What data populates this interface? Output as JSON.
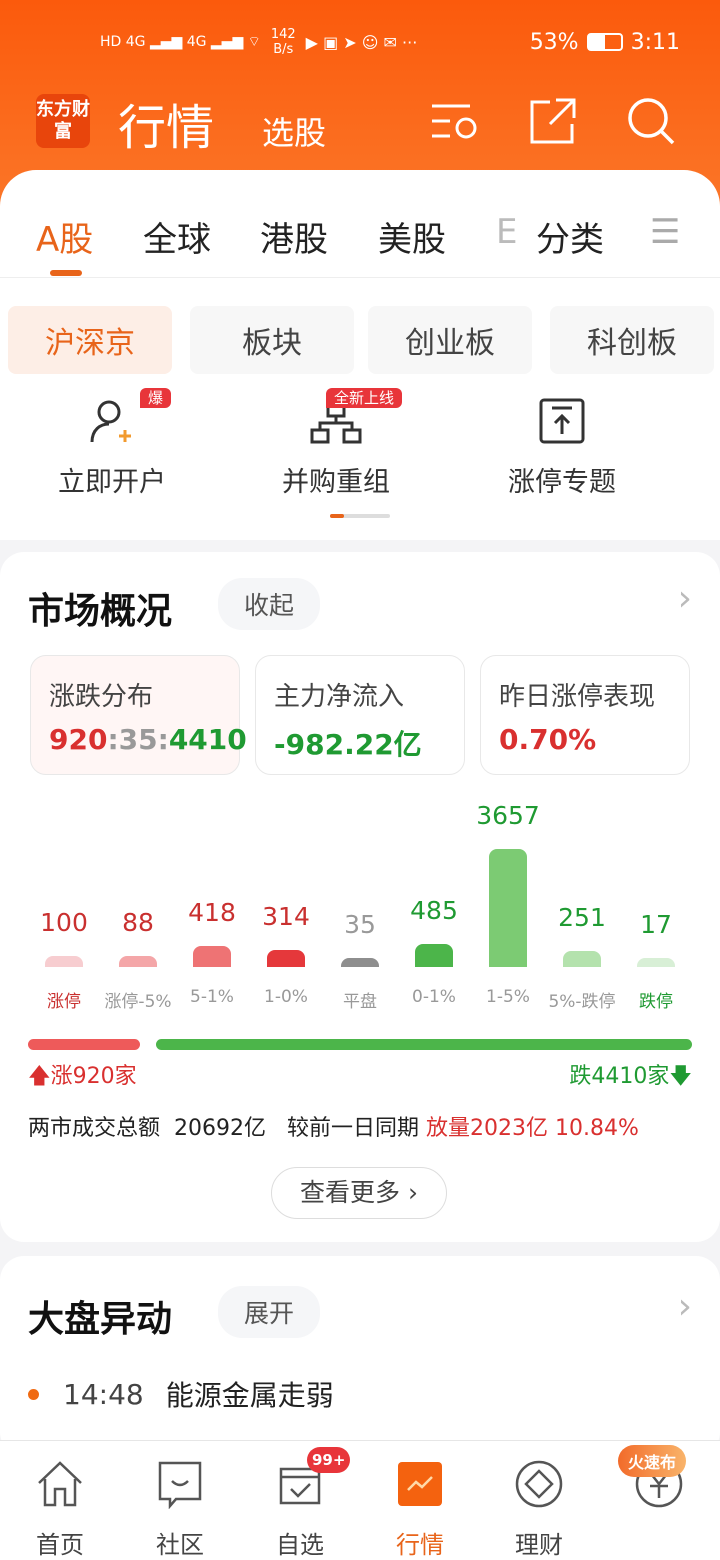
{
  "status_bar": {
    "net_speed": "142",
    "net_unit": "B/s",
    "battery": "53%",
    "time": "3:11"
  },
  "header": {
    "logo": "东方财富",
    "title": "行情",
    "subtitle": "选股"
  },
  "tabs": [
    {
      "label": "A股"
    },
    {
      "label": "全球"
    },
    {
      "label": "港股"
    },
    {
      "label": "美股"
    },
    {
      "label": "E"
    },
    {
      "label": "分类"
    }
  ],
  "sub_tabs": [
    {
      "label": "沪深京"
    },
    {
      "label": "板块"
    },
    {
      "label": "创业板"
    },
    {
      "label": "科创板"
    }
  ],
  "shortcuts": [
    {
      "label": "立即开户",
      "tag": "爆"
    },
    {
      "label": "并购重组",
      "tag": "全新上线"
    },
    {
      "label": "涨停专题"
    }
  ],
  "market": {
    "title": "市场概况",
    "toggle": "收起",
    "cards": [
      {
        "label": "涨跌分布",
        "up": "920",
        "sep1": ":",
        "flat": "35",
        "sep2": ":",
        "down": "4410"
      },
      {
        "label": "主力净流入",
        "value": "-982.22亿"
      },
      {
        "label": "昨日涨停表现",
        "value": "0.70%"
      }
    ],
    "up_total": "涨920家",
    "down_total": "跌4410家",
    "turnover_label": "两市成交总额",
    "turnover": "20692亿",
    "compare_label": "较前一日同期",
    "compare_value": "放量2023亿",
    "compare_pct": "10.84%",
    "more": "查看更多"
  },
  "chart_data": {
    "type": "bar",
    "categories": [
      "涨停",
      "涨停-5%",
      "5-1%",
      "1-0%",
      "平盘",
      "0-1%",
      "1-5%",
      "5%-跌停",
      "跌停"
    ],
    "values": [
      100,
      88,
      418,
      314,
      35,
      485,
      3657,
      251,
      17
    ],
    "colors": [
      "#f7cdd0",
      "#f4a6a8",
      "#ee7374",
      "#e5383b",
      "#8e8e8e",
      "#4cb54a",
      "#7ccb73",
      "#b4e2ad",
      "#d8efd6"
    ],
    "label_colors": [
      "#c9302f",
      "#c9302f",
      "#c9302f",
      "#c9302f",
      "#999999",
      "#1f9a32",
      "#1f9a32",
      "#1f9a32",
      "#1f9a32"
    ]
  },
  "movers": {
    "title": "大盘异动",
    "toggle": "展开",
    "items": [
      {
        "time": "14:48",
        "text": "能源金属走弱"
      }
    ]
  },
  "bottom_nav": [
    {
      "label": "首页"
    },
    {
      "label": "社区"
    },
    {
      "label": "自选",
      "badge": "99+"
    },
    {
      "label": "行情"
    },
    {
      "label": "理财"
    },
    {
      "label": "",
      "badge": "火速布"
    }
  ]
}
